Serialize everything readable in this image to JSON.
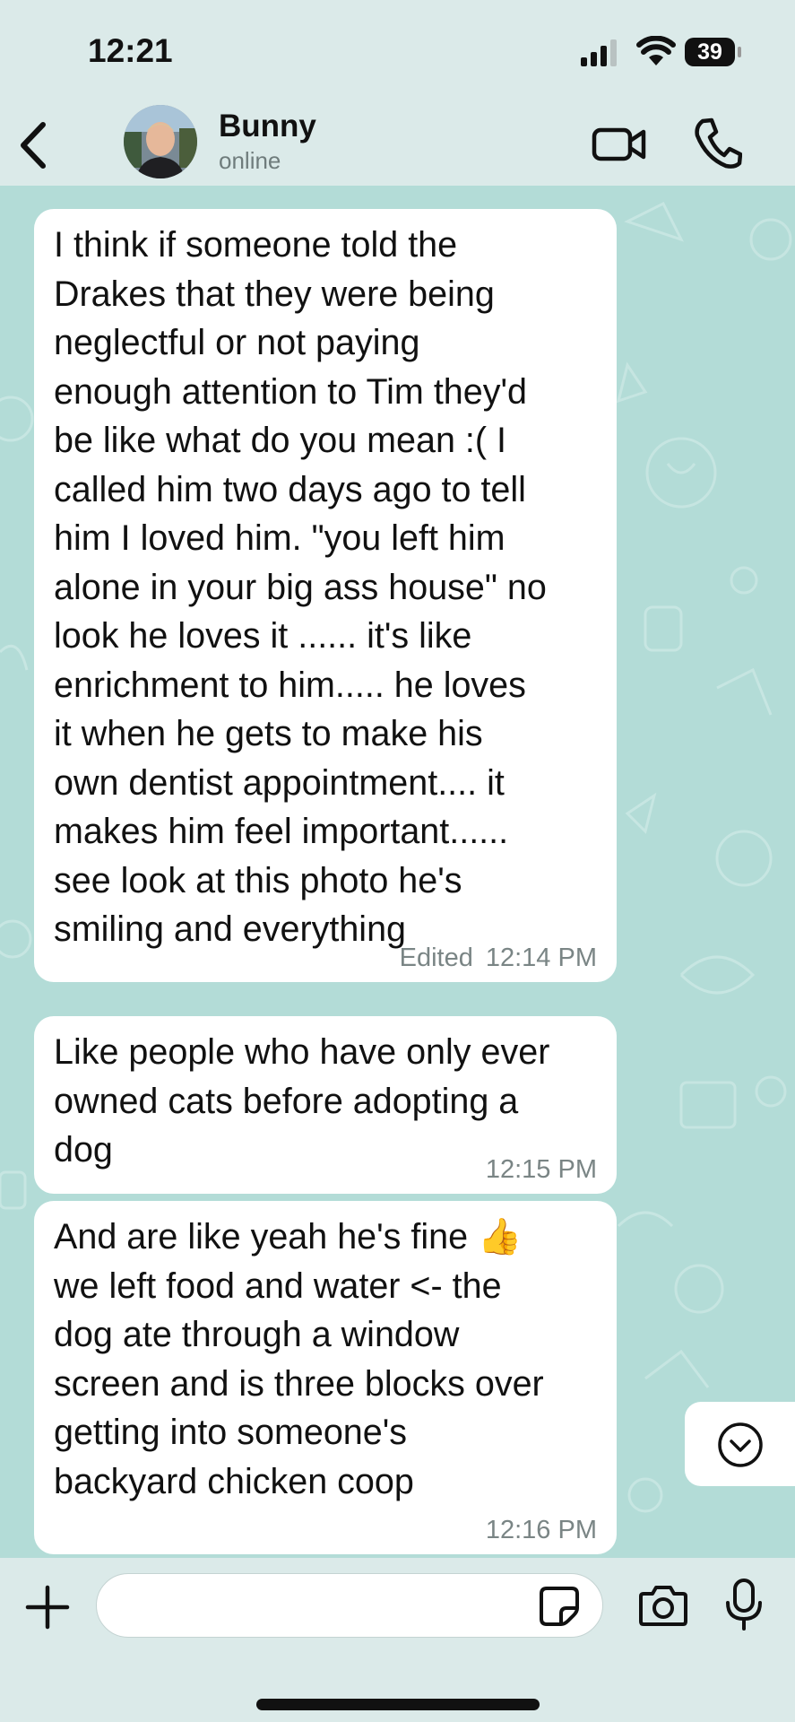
{
  "status_bar": {
    "time": "12:21",
    "battery_level": "39",
    "icons": [
      "cellular-signal-icon",
      "wifi-icon",
      "battery-icon"
    ]
  },
  "header": {
    "contact_name": "Bunny",
    "contact_status": "online",
    "icons": [
      "chevron-left-icon",
      "video-camera-icon",
      "phone-icon"
    ]
  },
  "messages": [
    {
      "text": "I think if someone told the\nDrakes that they were being\nneglectful or not paying\nenough attention to Tim they'd\nbe like what do you mean :( I\ncalled him two days ago to tell\nhim I loved him. \"you left him\nalone in your big ass house\" no\nlook he loves it ...... it's like\nenrichment to him..... he loves\nit when he gets to make his\nown dentist appointment.... it\nmakes him feel important......\nsee look at this photo he's\nsmiling and everything",
      "edited_label": "Edited",
      "time": "12:14 PM"
    },
    {
      "text": "Like people who have only ever\nowned cats before adopting a\ndog",
      "time": "12:15 PM"
    },
    {
      "text": "And are like yeah he's fine 👍\nwe left food and water <- the\ndog ate through a window\nscreen and is three blocks over\ngetting into someone's\nbackyard chicken coop",
      "time": "12:16 PM"
    }
  ],
  "composer": {
    "input_value": "",
    "icons": [
      "plus-icon",
      "sticker-icon",
      "camera-icon",
      "microphone-icon"
    ]
  },
  "colors": {
    "chat_background": "#b3dcd7",
    "bar_background": "#dbeae9",
    "bubble": "#ffffff",
    "meta_text": "#7a8585"
  }
}
